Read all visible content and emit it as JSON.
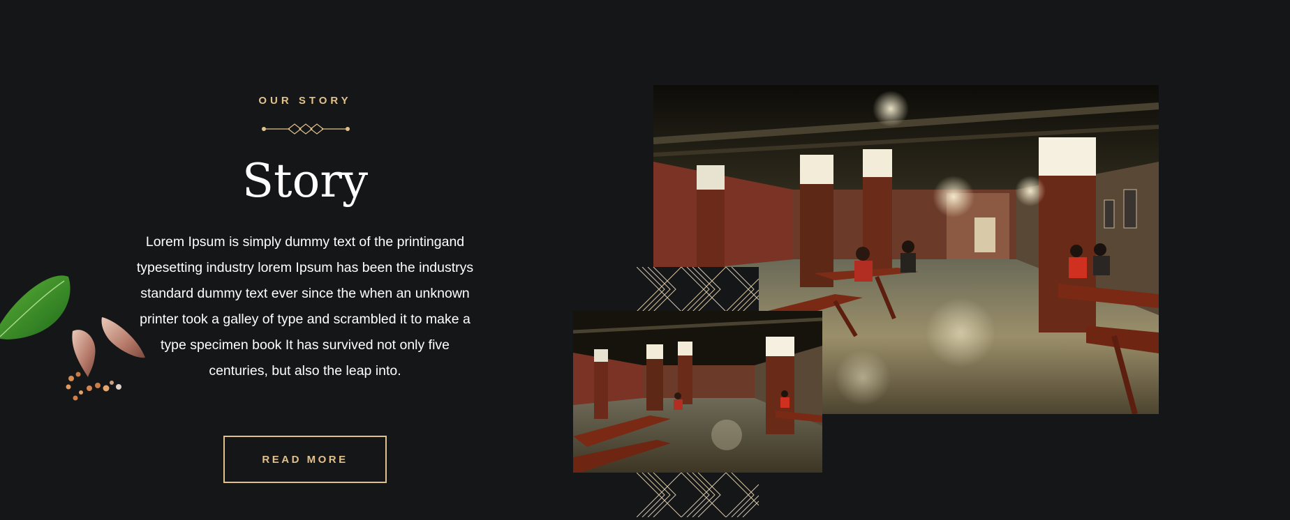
{
  "section": {
    "eyebrow": "OUR STORY",
    "title": "Story",
    "body": "Lorem Ipsum is simply dummy text of the printingand typesetting industry lorem Ipsum has been the industrys standard dummy text ever since the when an unknown printer took a galley of type and scrambled it to make a type specimen book It has survived not only five centuries, but also the leap into.",
    "button_label": "READ MORE"
  },
  "colors": {
    "background": "#151618",
    "accent_gold": "#e2c28c",
    "text": "#ffffff"
  },
  "icons": {
    "ornament": "diamond-divider-icon",
    "spices": "basil-garlic-peppercorn-illustration",
    "pattern": "art-deco-pattern"
  }
}
